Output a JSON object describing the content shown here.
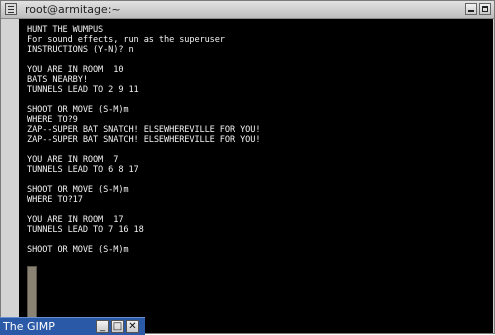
{
  "window": {
    "title": "root@armitage:~"
  },
  "terminal": {
    "lines": [
      "HUNT THE WUMPUS",
      "For sound effects, run as the superuser",
      "INSTRUCTIONS (Y-N)? n",
      "",
      "YOU ARE IN ROOM  10",
      "BATS NEARBY!",
      "TUNNELS LEAD TO 2 9 11",
      "",
      "SHOOT OR MOVE (S-M)m",
      "WHERE TO?9",
      "ZAP--SUPER BAT SNATCH! ELSEWHEREVILLE FOR YOU!",
      "ZAP--SUPER BAT SNATCH! ELSEWHEREVILLE FOR YOU!",
      "",
      "YOU ARE IN ROOM  7",
      "TUNNELS LEAD TO 6 8 17",
      "",
      "SHOOT OR MOVE (S-M)m",
      "WHERE TO?17",
      "",
      "YOU ARE IN ROOM  17",
      "TUNNELS LEAD TO 7 16 18",
      "",
      "SHOOT OR MOVE (S-M)m"
    ]
  },
  "taskbar": {
    "app_label": "The GIMP",
    "buttons": [
      "_",
      "□",
      "✕"
    ]
  },
  "colors": {
    "terminal_bg": "#000000",
    "terminal_fg": "#f2f2f2",
    "taskbar_bg": "#2a59a8"
  }
}
